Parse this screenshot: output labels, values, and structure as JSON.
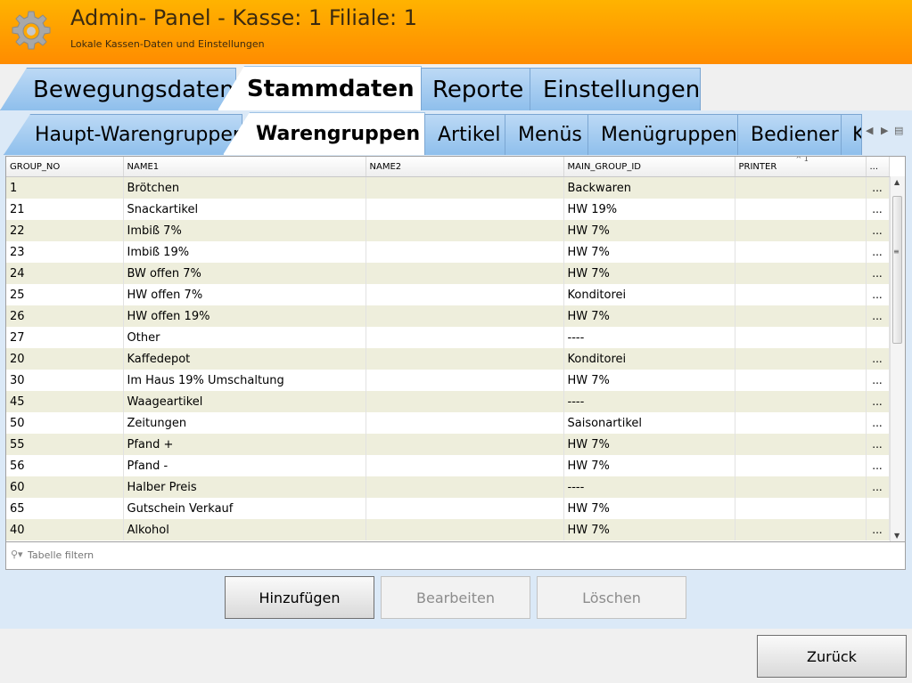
{
  "header": {
    "title": "Admin- Panel - Kasse: 1 Filiale: 1",
    "subtitle": "Lokale Kassen-Daten und Einstellungen",
    "icon": "gear-icon"
  },
  "main_tabs": [
    {
      "label": "Bewegungsdaten"
    },
    {
      "label": "Stammdaten",
      "active": true
    },
    {
      "label": "Reporte"
    },
    {
      "label": "Einstellungen"
    }
  ],
  "sub_tabs": [
    {
      "label": "Haupt-Warengruppen"
    },
    {
      "label": "Warengruppen",
      "active": true
    },
    {
      "label": "Artikel"
    },
    {
      "label": "Menüs"
    },
    {
      "label": "Menügruppen"
    },
    {
      "label": "Bediener"
    },
    {
      "label": "K"
    }
  ],
  "table": {
    "columns": [
      "GROUP_NO",
      "NAME1",
      "NAME2",
      "MAIN_GROUP_ID",
      "PRINTER",
      "..."
    ],
    "sort_indicator": "1",
    "rows": [
      {
        "group_no": "1",
        "name1": "Brötchen",
        "name2": "",
        "main_group": "Backwaren",
        "printer": "",
        "action": "..."
      },
      {
        "group_no": "21",
        "name1": "Snackartikel",
        "name2": "",
        "main_group": "HW 19%",
        "printer": "",
        "action": "..."
      },
      {
        "group_no": "22",
        "name1": "Imbiß 7%",
        "name2": "",
        "main_group": "HW 7%",
        "printer": "",
        "action": "..."
      },
      {
        "group_no": "23",
        "name1": "Imbiß 19%",
        "name2": "",
        "main_group": "HW 7%",
        "printer": "",
        "action": "..."
      },
      {
        "group_no": "24",
        "name1": "BW offen 7%",
        "name2": "",
        "main_group": "HW 7%",
        "printer": "",
        "action": "..."
      },
      {
        "group_no": "25",
        "name1": "HW offen 7%",
        "name2": "",
        "main_group": "Konditorei",
        "printer": "",
        "action": "..."
      },
      {
        "group_no": "26",
        "name1": "HW offen 19%",
        "name2": "",
        "main_group": "HW 7%",
        "printer": "",
        "action": "..."
      },
      {
        "group_no": "27",
        "name1": "Other",
        "name2": "",
        "main_group": "----",
        "printer": "",
        "action": ""
      },
      {
        "group_no": "20",
        "name1": "Kaffedepot",
        "name2": "",
        "main_group": "Konditorei",
        "printer": "",
        "action": "..."
      },
      {
        "group_no": "30",
        "name1": "Im Haus 19% Umschaltung",
        "name2": "",
        "main_group": "HW 7%",
        "printer": "",
        "action": "..."
      },
      {
        "group_no": "45",
        "name1": "Waageartikel",
        "name2": "",
        "main_group": "----",
        "printer": "",
        "action": "..."
      },
      {
        "group_no": "50",
        "name1": "Zeitungen",
        "name2": "",
        "main_group": "Saisonartikel",
        "printer": "",
        "action": "..."
      },
      {
        "group_no": "55",
        "name1": "Pfand +",
        "name2": "",
        "main_group": "HW 7%",
        "printer": "",
        "action": "..."
      },
      {
        "group_no": "56",
        "name1": "Pfand -",
        "name2": "",
        "main_group": "HW 7%",
        "printer": "",
        "action": "..."
      },
      {
        "group_no": "60",
        "name1": "Halber Preis",
        "name2": "",
        "main_group": "----",
        "printer": "",
        "action": "..."
      },
      {
        "group_no": "65",
        "name1": "Gutschein Verkauf",
        "name2": "",
        "main_group": "HW 7%",
        "printer": "",
        "action": ""
      },
      {
        "group_no": "40",
        "name1": "Alkohol",
        "name2": "",
        "main_group": "HW 7%",
        "printer": "",
        "action": "..."
      }
    ]
  },
  "filter": {
    "placeholder": "Tabelle filtern"
  },
  "buttons": {
    "add": "Hinzufügen",
    "edit": "Bearbeiten",
    "delete": "Löschen",
    "back": "Zurück"
  },
  "colors": {
    "header_orange": "#ff9b00",
    "tab_blue": "#8fbfec",
    "row_alt": "#eeeedc"
  }
}
